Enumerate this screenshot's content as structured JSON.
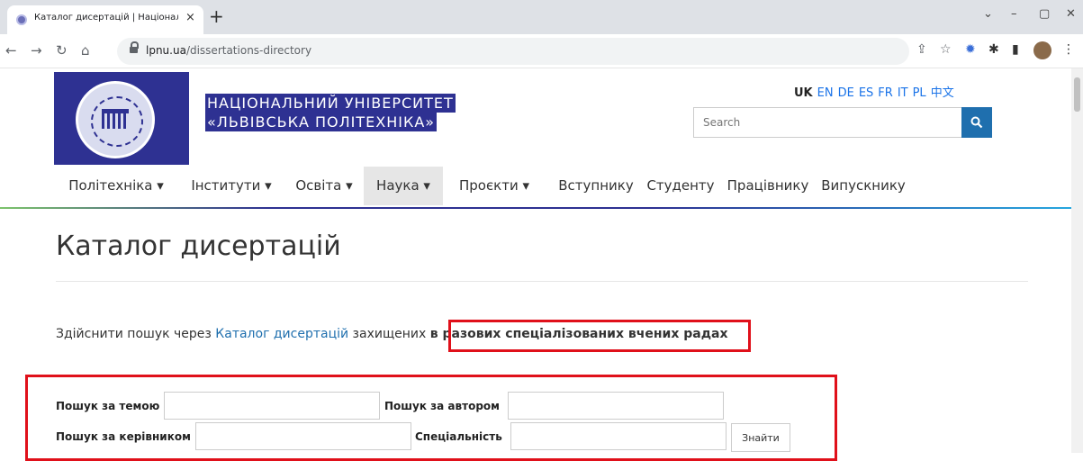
{
  "browser": {
    "tab_title": "Каталог дисертацій | Національ",
    "tab_close": "×",
    "new_tab": "+",
    "url_host": "lpnu.ua",
    "url_path": "/dissertations-directory",
    "controls": {
      "minimize": "–",
      "restore": "▢",
      "close": "✕",
      "dropdown": "⌄"
    },
    "nav": {
      "back": "←",
      "forward": "→",
      "reload": "↻",
      "home": "⌂"
    },
    "toolbar_icons": {
      "share": "⇪",
      "bookmark": "☆",
      "extension_1": "✹",
      "extensions": "✱",
      "sidebar": "▮",
      "menu": "⋮"
    }
  },
  "site": {
    "name_line1": "НАЦІОНАЛЬНИЙ УНІВЕРСИТЕТ",
    "name_line2": "«ЛЬВІВСЬКА ПОЛІТЕХНІКА»",
    "languages": [
      {
        "code": "UK",
        "active": true
      },
      {
        "code": "EN",
        "active": false
      },
      {
        "code": "DE",
        "active": false
      },
      {
        "code": "ES",
        "active": false
      },
      {
        "code": "FR",
        "active": false
      },
      {
        "code": "IT",
        "active": false
      },
      {
        "code": "PL",
        "active": false
      },
      {
        "code": "中文",
        "active": false
      }
    ],
    "search_placeholder": "Search",
    "brand_color": "#2e3192",
    "accent_color": "#1f6fae"
  },
  "nav": {
    "items": [
      {
        "label": "Політехніка ▾"
      },
      {
        "label": "Інститути ▾"
      },
      {
        "label": "Освіта ▾"
      },
      {
        "label": "Наука ▾",
        "active": true
      },
      {
        "label": "Проєкти ▾"
      },
      {
        "label": "Вступнику"
      },
      {
        "label": "Студенту"
      },
      {
        "label": "Працівнику"
      },
      {
        "label": "Випускнику"
      }
    ]
  },
  "content": {
    "title": "Каталог дисертацій",
    "intro_prefix": "Здійснити пошук через ",
    "intro_link": "Каталог дисертацій",
    "intro_middle": " захищених ",
    "intro_bold": "в разових спеціалізованих вчених радах",
    "highlight_color": "#e0101a"
  },
  "form": {
    "topic_label": "Пошук за темою",
    "author_label": "Пошук за автором",
    "supervisor_label": "Пошук за керівником",
    "specialty_label": "Спеціальність",
    "submit_label": "Знайти"
  }
}
